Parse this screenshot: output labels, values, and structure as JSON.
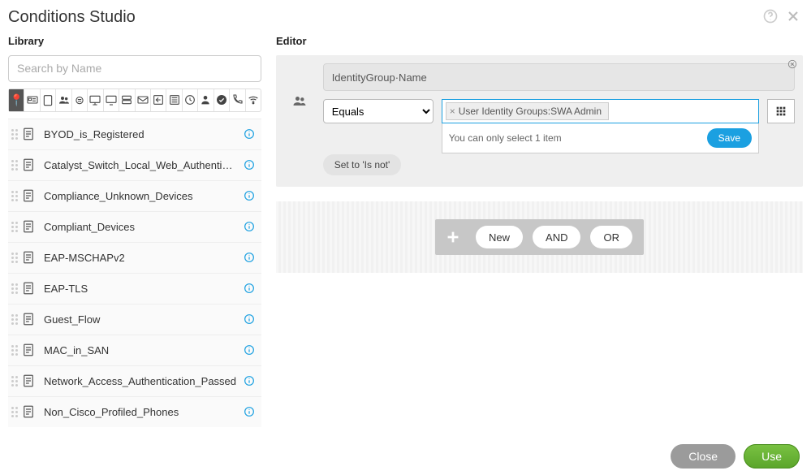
{
  "header": {
    "title": "Conditions Studio"
  },
  "library": {
    "heading": "Library",
    "search_placeholder": "Search by Name",
    "filters": [
      "pin-icon",
      "id-card-icon",
      "device-icon",
      "group-icon",
      "globe-icon",
      "desktop-icon",
      "display-icon",
      "server-icon",
      "mail-icon",
      "collapse-icon",
      "list-icon",
      "clock-icon",
      "person-icon",
      "check-circle-icon",
      "phone-icon",
      "wifi-icon"
    ],
    "items": [
      {
        "label": "BYOD_is_Registered"
      },
      {
        "label": "Catalyst_Switch_Local_Web_Authentication"
      },
      {
        "label": "Compliance_Unknown_Devices"
      },
      {
        "label": "Compliant_Devices"
      },
      {
        "label": "EAP-MSCHAPv2"
      },
      {
        "label": "EAP-TLS"
      },
      {
        "label": "Guest_Flow"
      },
      {
        "label": "MAC_in_SAN"
      },
      {
        "label": "Network_Access_Authentication_Passed"
      },
      {
        "label": "Non_Cisco_Profiled_Phones"
      }
    ]
  },
  "editor": {
    "heading": "Editor",
    "attribute": "IdentityGroup·Name",
    "operator": "Equals",
    "value_token": "User Identity Groups:SWA Admin",
    "set_not_label": "Set to 'Is not'",
    "drop_hint": "You can only select 1 item",
    "save_label": "Save",
    "add": {
      "new": "New",
      "and": "AND",
      "or": "OR"
    }
  },
  "footer": {
    "close": "Close",
    "use": "Use"
  }
}
